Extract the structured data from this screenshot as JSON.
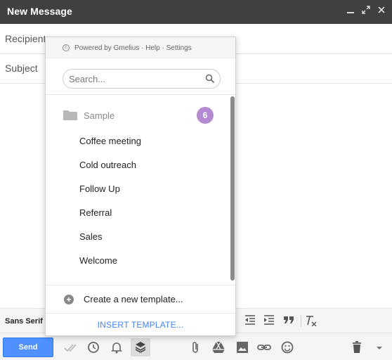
{
  "window": {
    "title": "New Message",
    "controls": [
      "minimize-icon",
      "expand-icon",
      "close-icon"
    ]
  },
  "fields": {
    "recipients_label": "Recipients",
    "subject_label": "Subject"
  },
  "popup": {
    "powered_text": "Powered by Gmelius · Help · Settings",
    "search_placeholder": "Search...",
    "folder": {
      "name": "Sample",
      "count": "6"
    },
    "templates": [
      "Coffee meeting",
      "Cold outreach",
      "Follow Up",
      "Referral",
      "Sales",
      "Welcome"
    ],
    "create_label": "Create a new template...",
    "insert_label": "INSERT TEMPLATE..."
  },
  "format_bar": {
    "font_label": "Sans Serif",
    "icons": [
      "indent-less-icon",
      "indent-more-icon",
      "quote-icon",
      "remove-formatting-icon"
    ]
  },
  "bottom_bar": {
    "send_label": "Send",
    "icons": [
      "double-check-icon",
      "clock-icon",
      "bell-icon",
      "layers-icon",
      "attach-icon",
      "drive-icon",
      "image-icon",
      "link-icon",
      "emoji-icon",
      "trash-icon",
      "more-options-icon"
    ]
  },
  "colors": {
    "titlebar": "#404040",
    "send": "#4d90fe",
    "badge": "#b48ad2",
    "insert_link": "#4285f4"
  }
}
